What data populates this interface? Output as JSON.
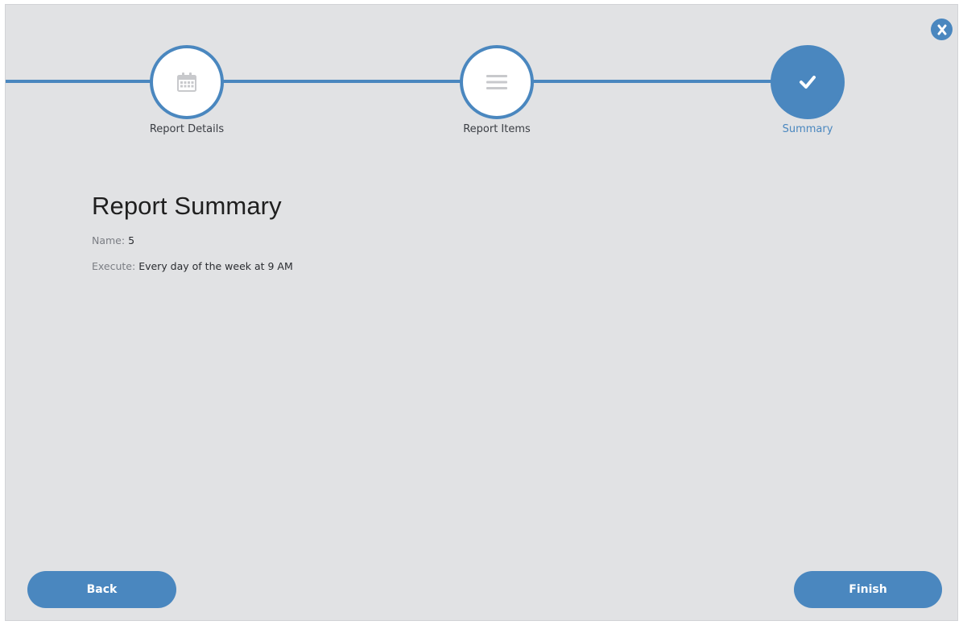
{
  "wizard": {
    "steps": [
      {
        "label": "Report Details",
        "icon": "calendar-icon",
        "state": "completed"
      },
      {
        "label": "Report Items",
        "icon": "list-icon",
        "state": "completed"
      },
      {
        "label": "Summary",
        "icon": "check-icon",
        "state": "active"
      }
    ],
    "accent_color": "#4a87bf"
  },
  "summary": {
    "title": "Report Summary",
    "name_label": "Name:",
    "name_value": "5",
    "execute_label": "Execute:",
    "execute_value": "Every day of the week at 9 AM"
  },
  "footer": {
    "back_label": "Back",
    "finish_label": "Finish"
  }
}
